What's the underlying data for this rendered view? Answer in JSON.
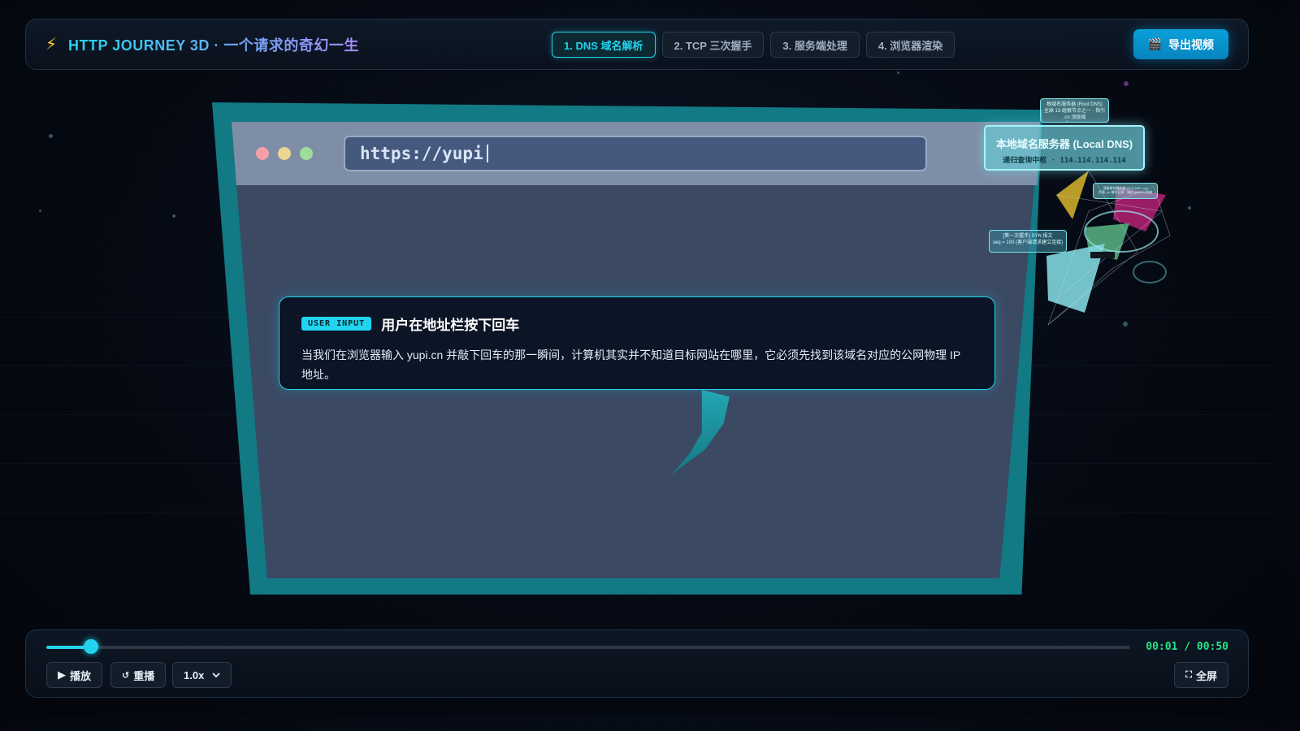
{
  "header": {
    "bolt_icon": "⚡",
    "title": "HTTP JOURNEY 3D · 一个请求的奇幻一生",
    "tabs": [
      {
        "label": "1. DNS 域名解析",
        "active": true
      },
      {
        "label": "2. TCP 三次握手",
        "active": false
      },
      {
        "label": "3. 服务端处理",
        "active": false
      },
      {
        "label": "4. 浏览器渲染",
        "active": false
      }
    ],
    "export_icon": "🎬",
    "export_label": "导出视频"
  },
  "browser": {
    "url_text": "https://yupi"
  },
  "card": {
    "badge": "USER INPUT",
    "title": "用户在地址栏按下回车",
    "body": "当我们在浏览器输入 yupi.cn 并敲下回车的那一瞬间，计算机其实并不知道目标网站在哪里，它必须先找到该域名对应的公网物理 IP 地址。"
  },
  "nodes": {
    "local_dns_title": "本地域名服务器 (Local DNS)",
    "local_dns_sub": "递归查询中枢 · 114.114.114.114",
    "root_dns_title": "根域名服务器 (Root DNS)",
    "root_dns_sub": "全球 13 组根节点之一 · 指引 .cn 顶级域",
    "tld_dns_title": "顶级域名服务器 (TLD DNS .cn)",
    "tld_dns_sub": "负责 .cn 域名记录 · 指向 yupi.cn 权威",
    "syn_title": "[第一次握手] SYN 报文",
    "syn_sub": "seq = 100 (客户端请求建立连接)"
  },
  "controls": {
    "progress": 0.041,
    "time": "00:01 / 00:50",
    "play_icon": "▶",
    "play_label": "播放",
    "replay_icon": "↺",
    "replay_label": "重播",
    "speed_value": "1.0x",
    "fullscreen_icon": "⛶",
    "fullscreen_label": "全屏"
  },
  "colors": {
    "accent": "#22d3ee",
    "time_green": "#22e38a",
    "frame_teal": "#117a84",
    "dot_red": "#f2a0a6",
    "dot_yellow": "#e9d68f",
    "dot_green": "#9fdc9b"
  }
}
